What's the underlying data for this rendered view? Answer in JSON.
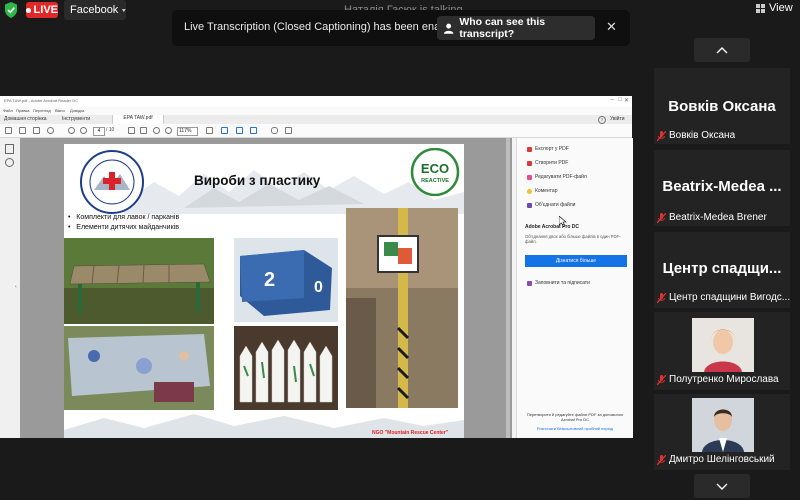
{
  "topbar": {
    "live_label": "LIVE",
    "facebook_label": "Facebook",
    "talking_text": "Наталія Гасюк is talking...",
    "view_label": "View"
  },
  "banner": {
    "text": "Live Transcription (Closed Captioning) has been enabled",
    "who_button": "Who can see this transcript?"
  },
  "participants": [
    {
      "name": "Вовків Оксана",
      "subname": "Вовків Оксана"
    },
    {
      "name": "Beatrix-Medea ...",
      "subname": "Beatrix-Medea Brener"
    },
    {
      "name": "Центр спадщи...",
      "subname": "Центр спадщини Вигодс..."
    },
    {
      "name": "",
      "subname": "Полутренко Мирослава"
    },
    {
      "name": "",
      "subname": "Дмитро Шелінговський"
    }
  ],
  "acrobat": {
    "title": "EPA TAW.pdf - Adobe Acrobat Reader DC",
    "menu": [
      "Файл",
      "Правка",
      "Перегляд",
      "Вікно",
      "Довідка"
    ],
    "tabs": [
      "Домашня сторінка",
      "Інструменти"
    ],
    "file_tab": "EPA TAW.pdf",
    "signin": "Увійти",
    "page_current": "4",
    "page_total": "/ 10",
    "zoom": "117%",
    "panel_items": [
      "Експорт у PDF",
      "Створити PDF",
      "Редагувати PDF-файл",
      "Коментар",
      "Об'єднати файли"
    ],
    "promo_title": "Adobe Acrobat Pro DC",
    "promo_text": "Об'єднання двох або більше файлів в один PDF-файл.",
    "promo_button": "Дізнатися більше",
    "sign_label": "Заповнити та підписати",
    "bottom_text": "Перетворити й редагуйте файли PDF за допомогою Acrobat Pro DC",
    "bottom_link": "Розпочати безкоштовний пробний період"
  },
  "slide": {
    "title": "Вироби з пластику",
    "logo_top": "ECO",
    "logo_bottom": "REACTIVE",
    "bullets": [
      "Комплекти для лавок / парканів",
      "Елементи дитячих майданчиків"
    ],
    "footer": "NGO \"Mountain Rescue Center\""
  },
  "colors": {
    "live_red": "#e02828",
    "promo_blue": "#1473e6",
    "tile_bg": "#232323"
  }
}
